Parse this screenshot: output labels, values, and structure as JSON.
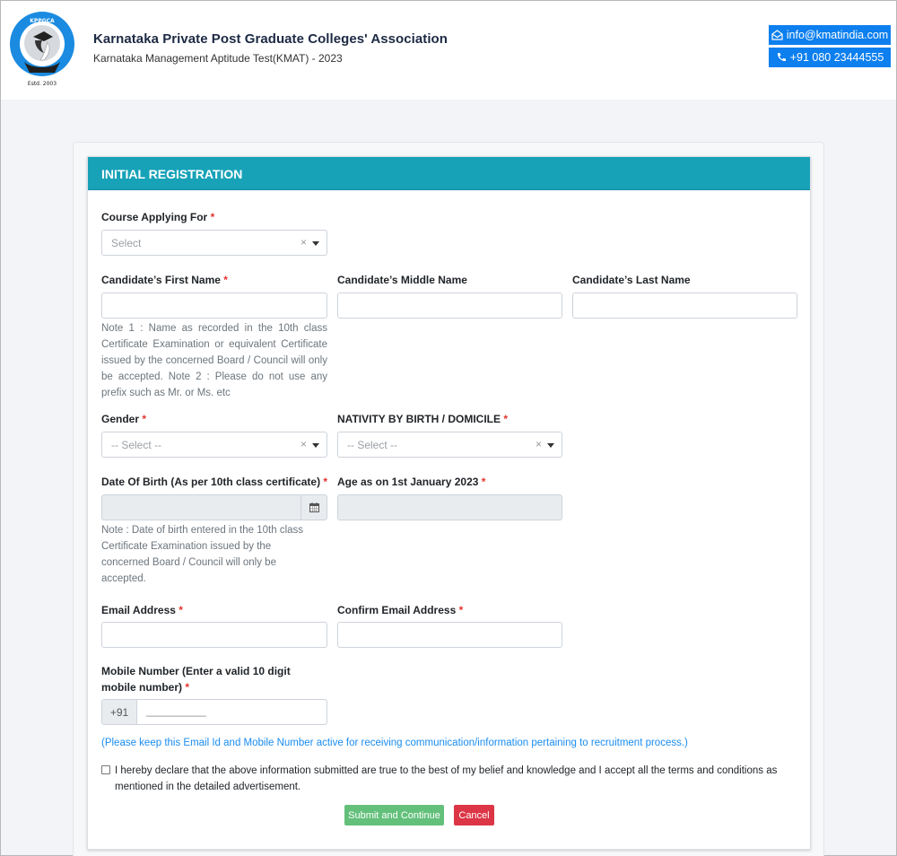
{
  "header": {
    "logo_label": "Estd. 2003",
    "org_title": "Karnataka Private Post Graduate Colleges' Association",
    "org_subtitle": "Karnataka Management Aptitude Test(KMAT) - 2023",
    "email": "info@kmatindia.com",
    "phone": "+91 080 23444555",
    "email_icon": "envelope-open-icon",
    "phone_icon": "phone-icon",
    "accent_color": "#0d7fee"
  },
  "form": {
    "title": "INITIAL REGISTRATION",
    "header_color": "#17a2b8",
    "required_mark": "*",
    "course": {
      "label": "Course Applying For",
      "placeholder": "Select",
      "clear": "×"
    },
    "first_name": {
      "label": "Candidate’s First Name",
      "value": ""
    },
    "middle_name": {
      "label": "Candidate’s Middle Name",
      "value": ""
    },
    "last_name": {
      "label": "Candidate’s Last Name",
      "value": ""
    },
    "name_note": "Note 1 : Name as recorded in the 10th class Certificate Examination or equivalent Certificate issued by the concerned Board / Council will only be accepted. Note 2 : Please do not use any prefix such as Mr. or Ms. etc",
    "gender": {
      "label": "Gender",
      "placeholder": "-- Select --",
      "clear": "×"
    },
    "nativity": {
      "label": "NATIVITY BY BIRTH / DOMICILE",
      "placeholder": "-- Select --",
      "clear": "×"
    },
    "dob": {
      "label": "Date Of Birth (As per 10th class certificate)",
      "value": ""
    },
    "age": {
      "label": "Age as on 1st January 2023",
      "value": ""
    },
    "dob_note": "Note : Date of birth entered in the 10th class Certificate Examination issued by the concerned Board / Council will only be accepted.",
    "email": {
      "label": "Email Address",
      "value": ""
    },
    "confirm_email": {
      "label": "Confirm Email Address",
      "value": ""
    },
    "mobile": {
      "label": "Mobile Number (Enter a valid 10 digit mobile number)",
      "prefix": "+91",
      "mask": "__________"
    },
    "info_text": "(Please keep this Email Id and Mobile Number active for receiving communication/information pertaining to recruitment process.)",
    "declaration": "I hereby declare that the above information submitted are true to the best of my belief and knowledge and I accept all the terms and conditions as mentioned in the detailed advertisement.",
    "declaration_checked": false,
    "submit_label": "Submit and Continue",
    "cancel_label": "Cancel",
    "submit_color": "#63c07b",
    "cancel_color": "#dc3545"
  }
}
